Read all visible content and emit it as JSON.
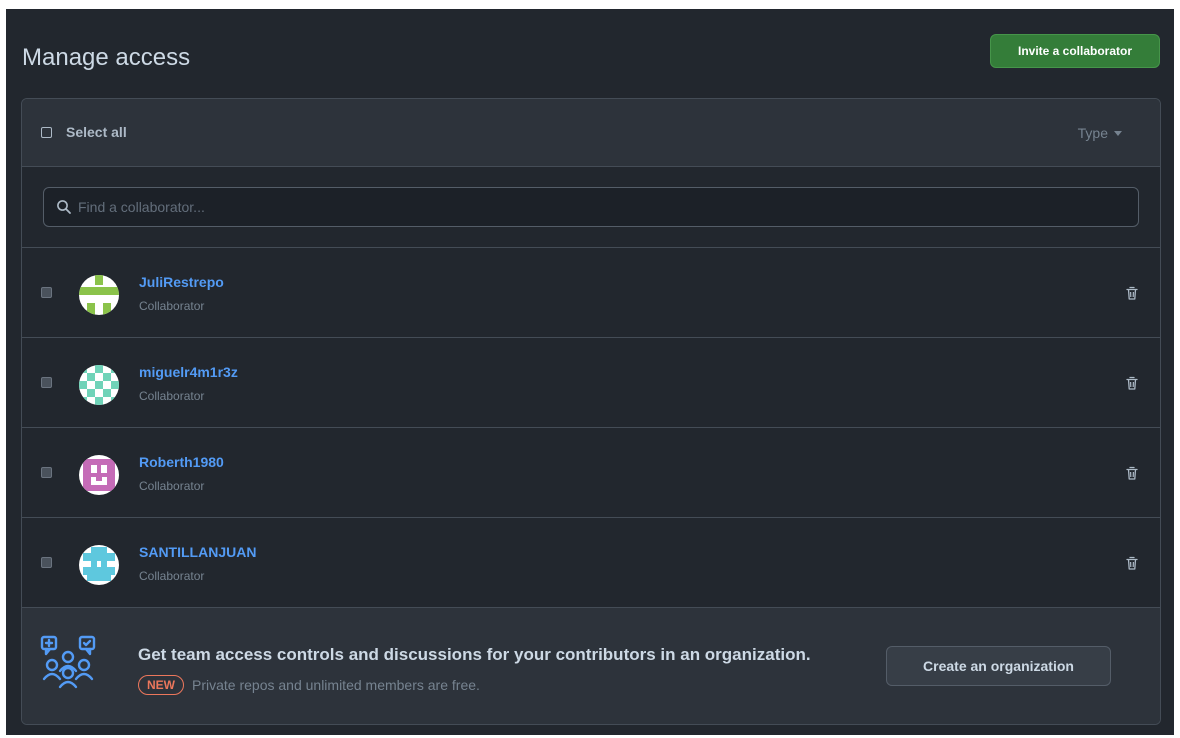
{
  "header": {
    "title": "Manage access",
    "invite_label": "Invite a collaborator"
  },
  "list_header": {
    "select_all_label": "Select all",
    "type_filter_label": "Type"
  },
  "search": {
    "placeholder": "Find a collaborator...",
    "value": ""
  },
  "collaborators": [
    {
      "name": "JuliRestrepo",
      "role": "Collaborator",
      "avatar_color": "#8bc34a"
    },
    {
      "name": "miguelr4m1r3z",
      "role": "Collaborator",
      "avatar_color": "#6fd3b8"
    },
    {
      "name": "Roberth1980",
      "role": "Collaborator",
      "avatar_color": "#c56bb7"
    },
    {
      "name": "SANTILLANJUAN",
      "role": "Collaborator",
      "avatar_color": "#5ec8de"
    }
  ],
  "footer": {
    "title": "Get team access controls and discussions for your contributors in an organization.",
    "badge": "NEW",
    "description": "Private repos and unlimited members are free.",
    "create_org_label": "Create an organization"
  },
  "colors": {
    "background": "#22272e",
    "accent_green": "#347d39",
    "link_blue": "#539bf5",
    "badge_orange": "#ec775c"
  }
}
